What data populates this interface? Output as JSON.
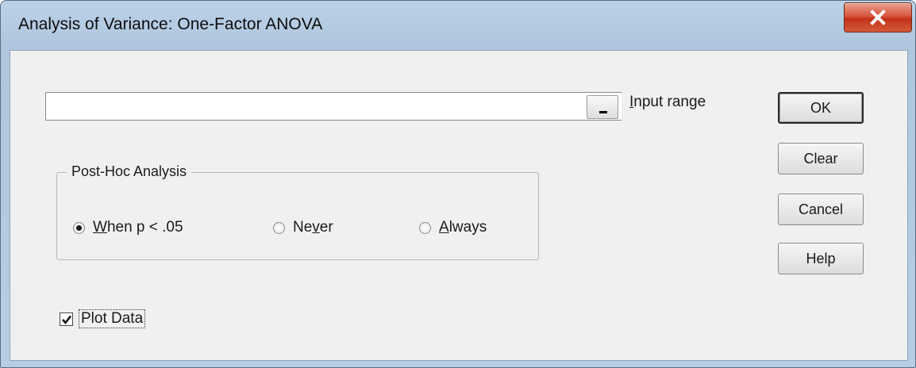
{
  "window": {
    "title": "Analysis of Variance: One-Factor ANOVA",
    "close_icon": "close-x-icon"
  },
  "input": {
    "value": "",
    "range_button_label": "_",
    "label_prefix": "I",
    "label_rest": "nput range"
  },
  "post_hoc": {
    "legend": "Post-Hoc Analysis",
    "options": [
      {
        "hotkey": "W",
        "rest": "hen p  < .05",
        "selected": true
      },
      {
        "pre": "Ne",
        "hotkey": "v",
        "rest": "er",
        "selected": false
      },
      {
        "hotkey": "A",
        "rest": "lways",
        "selected": false
      }
    ]
  },
  "plot_data": {
    "label": "Plot Data",
    "checked": true
  },
  "buttons": {
    "ok": "OK",
    "clear": "Clear",
    "cancel": "Cancel",
    "help": "Help"
  },
  "colors": {
    "close_button": "#c2321a",
    "window_frame": "#aec6de",
    "client_bg": "#f0f0f0"
  }
}
